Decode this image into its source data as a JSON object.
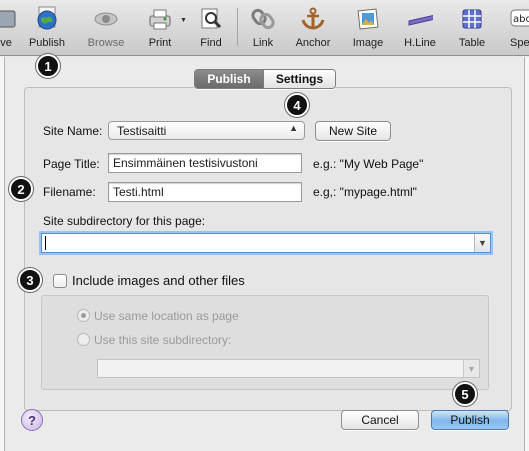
{
  "toolbar": {
    "items": [
      {
        "label": "ve",
        "icon": "save-icon"
      },
      {
        "label": "Publish",
        "icon": "globe-icon"
      },
      {
        "label": "Browse",
        "icon": "eye-icon"
      },
      {
        "label": "Print",
        "icon": "printer-icon"
      },
      {
        "label": "Find",
        "icon": "magnifier-icon"
      },
      {
        "label": "Link",
        "icon": "chain-link-icon"
      },
      {
        "label": "Anchor",
        "icon": "anchor-icon"
      },
      {
        "label": "Image",
        "icon": "picture-icon"
      },
      {
        "label": "H.Line",
        "icon": "horizontal-line-icon"
      },
      {
        "label": "Table",
        "icon": "table-grid-icon"
      },
      {
        "label": "Spel",
        "icon": "spell-check-icon"
      }
    ]
  },
  "tabs": {
    "publish": "Publish",
    "settings": "Settings"
  },
  "form": {
    "site_name_label": "Site Name:",
    "site_name_value": "Testisaitti",
    "new_site_button": "New Site",
    "page_title_label": "Page Title:",
    "page_title_value": "Ensimmäinen testisivustoni",
    "page_title_example": "e.g.: \"My Web Page\"",
    "filename_label": "Filename:",
    "filename_value": "Testi.html",
    "filename_example": "e.g,: \"mypage.html\"",
    "subdir_label": "Site subdirectory for this page:",
    "subdir_value": "",
    "include_label": "Include images and other files",
    "include_checked": false,
    "radio_same_location": "Use same location as page",
    "radio_site_subdir": "Use this site subdirectory:"
  },
  "buttons": {
    "cancel": "Cancel",
    "publish": "Publish",
    "help": "?"
  },
  "callouts": [
    "1",
    "2",
    "3",
    "4",
    "5"
  ],
  "colors": {
    "accent_button": "#7fb6ea",
    "help_button": "#c9b5e6",
    "callout": "#111111"
  }
}
